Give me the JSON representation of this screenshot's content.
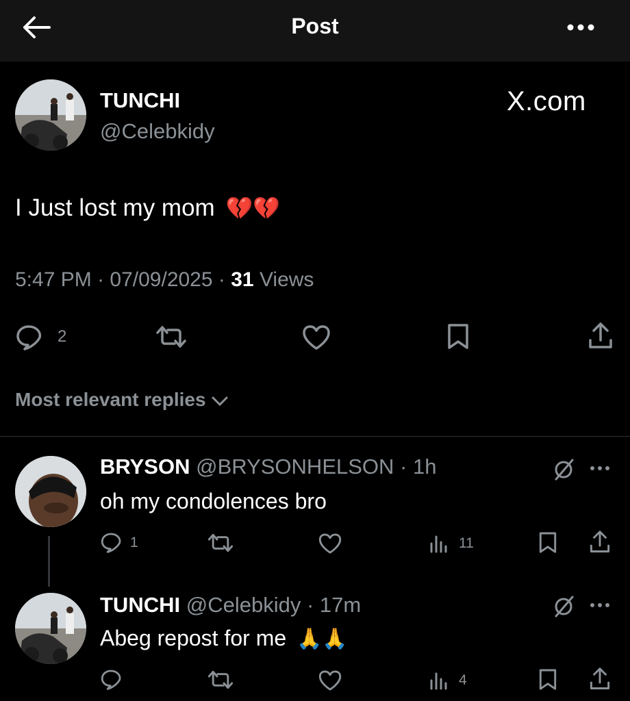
{
  "header": {
    "title": "Post"
  },
  "post": {
    "author_name": "TUNCHI",
    "author_handle": "@Celebkidy",
    "brand": "X.com",
    "text": "I Just lost my mom",
    "emoji": "💔💔",
    "time": "5:47 PM",
    "date": "07/09/2025",
    "views_count": "31",
    "views_label": "Views",
    "reply_count": "2"
  },
  "sort": {
    "label": "Most relevant replies"
  },
  "replies": [
    {
      "name": "BRYSON",
      "handle": "@BRYSONHELSON",
      "age": "1h",
      "text": "oh my condolences bro",
      "reply_count": "1",
      "views": "11"
    },
    {
      "name": "TUNCHI",
      "handle": "@Celebkidy",
      "age": "17m",
      "text": "Abeg repost for me",
      "emoji": "🙏🙏",
      "reply_count": "",
      "views": "4"
    }
  ],
  "colors": {
    "background": "#000000",
    "header": "#141414",
    "secondary_text": "#8b9196",
    "divider": "#2f3336",
    "broken_heart": "#e0245e",
    "pray": "#f5b83d"
  }
}
